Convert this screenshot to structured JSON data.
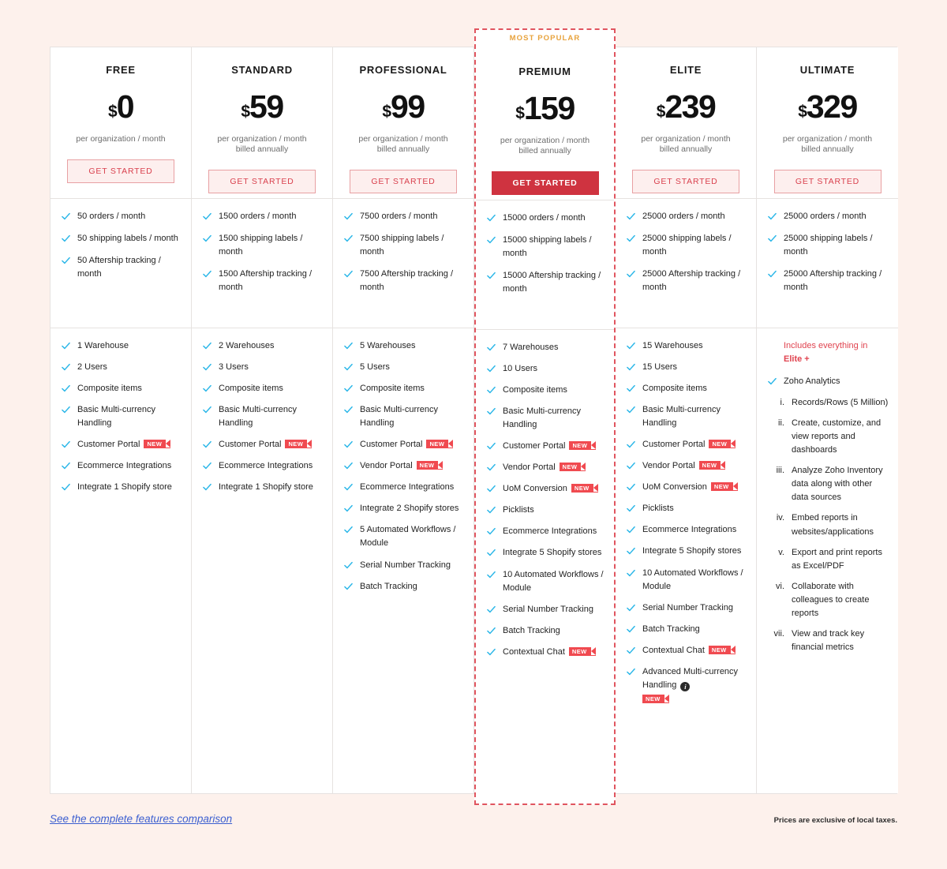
{
  "featured_label": "MOST POPULAR",
  "cta_label": "GET STARTED",
  "footer": {
    "compare_link": "See the complete features comparison",
    "taxes_note": "Prices are exclusive of local taxes."
  },
  "colors": {
    "page_background": "#fdf1ec",
    "accent_red": "#cf3340",
    "badge_red": "#f04a50",
    "check_blue": "#29b6e8",
    "most_popular_orange": "#e8a33d",
    "link_blue": "#3c5fd0"
  },
  "plans": [
    {
      "name": "FREE",
      "currency": "$",
      "amount": "0",
      "per": "per organization / month",
      "billed": "",
      "featured": false,
      "cta_style": "outline",
      "limits": [
        {
          "text": "50 orders / month"
        },
        {
          "text": "50 shipping labels / month"
        },
        {
          "text": "50 Aftership tracking / month"
        }
      ],
      "features": [
        {
          "text": "1 Warehouse"
        },
        {
          "text": "2 Users"
        },
        {
          "text": "Composite items"
        },
        {
          "text": "Basic Multi-currency Handling"
        },
        {
          "text": "Customer Portal",
          "badge": "NEW"
        },
        {
          "text": "Ecommerce Integrations"
        },
        {
          "text": "Integrate 1 Shopify store"
        }
      ]
    },
    {
      "name": "STANDARD",
      "currency": "$",
      "amount": "59",
      "per": "per organization / month",
      "billed": "billed annually",
      "featured": false,
      "cta_style": "outline",
      "limits": [
        {
          "text": "1500 orders / month"
        },
        {
          "text": "1500 shipping labels / month"
        },
        {
          "text": "1500 Aftership tracking / month"
        }
      ],
      "features": [
        {
          "text": "2 Warehouses"
        },
        {
          "text": "3 Users"
        },
        {
          "text": "Composite items"
        },
        {
          "text": "Basic Multi-currency Handling"
        },
        {
          "text": "Customer Portal",
          "badge": "NEW"
        },
        {
          "text": "Ecommerce Integrations"
        },
        {
          "text": "Integrate 1 Shopify store"
        }
      ]
    },
    {
      "name": "PROFESSIONAL",
      "currency": "$",
      "amount": "99",
      "per": "per organization / month",
      "billed": "billed annually",
      "featured": false,
      "cta_style": "outline",
      "limits": [
        {
          "text": "7500 orders / month"
        },
        {
          "text": "7500 shipping labels / month"
        },
        {
          "text": "7500 Aftership tracking / month"
        }
      ],
      "features": [
        {
          "text": "5 Warehouses"
        },
        {
          "text": "5 Users"
        },
        {
          "text": "Composite items"
        },
        {
          "text": "Basic Multi-currency Handling"
        },
        {
          "text": "Customer Portal",
          "badge": "NEW"
        },
        {
          "text": "Vendor Portal",
          "badge": "NEW"
        },
        {
          "text": "Ecommerce Integrations"
        },
        {
          "text": "Integrate 2 Shopify stores"
        },
        {
          "text": "5 Automated Workflows / Module"
        },
        {
          "text": "Serial Number Tracking"
        },
        {
          "text": "Batch Tracking"
        }
      ]
    },
    {
      "name": "PREMIUM",
      "currency": "$",
      "amount": "159",
      "per": "per organization / month",
      "billed": "billed annually",
      "featured": true,
      "cta_style": "primary",
      "limits": [
        {
          "text": "15000 orders / month"
        },
        {
          "text": "15000 shipping labels / month"
        },
        {
          "text": "15000 Aftership tracking / month"
        }
      ],
      "features": [
        {
          "text": "7 Warehouses"
        },
        {
          "text": "10 Users"
        },
        {
          "text": "Composite items"
        },
        {
          "text": "Basic Multi-currency Handling"
        },
        {
          "text": "Customer Portal",
          "badge": "NEW"
        },
        {
          "text": "Vendor Portal",
          "badge": "NEW"
        },
        {
          "text": "UoM Conversion",
          "badge": "NEW"
        },
        {
          "text": "Picklists"
        },
        {
          "text": "Ecommerce Integrations"
        },
        {
          "text": "Integrate 5 Shopify stores"
        },
        {
          "text": "10 Automated Workflows / Module"
        },
        {
          "text": "Serial Number Tracking"
        },
        {
          "text": "Batch Tracking"
        },
        {
          "text": "Contextual Chat",
          "badge": "NEW"
        }
      ]
    },
    {
      "name": "ELITE",
      "currency": "$",
      "amount": "239",
      "per": "per organization / month",
      "billed": "billed annually",
      "featured": false,
      "cta_style": "outline",
      "limits": [
        {
          "text": "25000 orders / month"
        },
        {
          "text": "25000 shipping labels / month"
        },
        {
          "text": "25000 Aftership tracking / month"
        }
      ],
      "features": [
        {
          "text": "15 Warehouses"
        },
        {
          "text": "15 Users"
        },
        {
          "text": "Composite items"
        },
        {
          "text": "Basic Multi-currency Handling"
        },
        {
          "text": "Customer Portal",
          "badge": "NEW"
        },
        {
          "text": "Vendor Portal",
          "badge": "NEW"
        },
        {
          "text": "UoM Conversion",
          "badge": "NEW"
        },
        {
          "text": "Picklists"
        },
        {
          "text": "Ecommerce Integrations"
        },
        {
          "text": "Integrate 5 Shopify stores"
        },
        {
          "text": "10 Automated Workflows / Module"
        },
        {
          "text": "Serial Number Tracking"
        },
        {
          "text": "Batch Tracking"
        },
        {
          "text": "Contextual Chat",
          "badge": "NEW"
        },
        {
          "text": "Advanced Multi-currency Handling",
          "info": "i",
          "badge_block": "NEW"
        }
      ]
    },
    {
      "name": "ULTIMATE",
      "currency": "$",
      "amount": "329",
      "per": "per organization / month",
      "billed": "billed annually",
      "featured": false,
      "cta_style": "outline",
      "limits": [
        {
          "text": "25000 orders / month"
        },
        {
          "text": "25000 shipping labels / month"
        },
        {
          "text": "25000 Aftership tracking / month"
        }
      ],
      "includes_note_line1": "Includes everything in",
      "includes_note_line2": "Elite +",
      "features": [
        {
          "text": "Zoho Analytics"
        }
      ],
      "sub_list": [
        {
          "num": "i.",
          "text": "Records/Rows (5 Million)"
        },
        {
          "num": "ii.",
          "text": "Create, customize, and view reports and dashboards"
        },
        {
          "num": "iii.",
          "text": "Analyze Zoho Inventory data along with other data sources"
        },
        {
          "num": "iv.",
          "text": "Embed reports in websites/applications"
        },
        {
          "num": "v.",
          "text": "Export and print reports as Excel/PDF"
        },
        {
          "num": "vi.",
          "text": "Collaborate with colleagues to create reports"
        },
        {
          "num": "vii.",
          "text": "View and track key financial metrics"
        }
      ]
    }
  ]
}
